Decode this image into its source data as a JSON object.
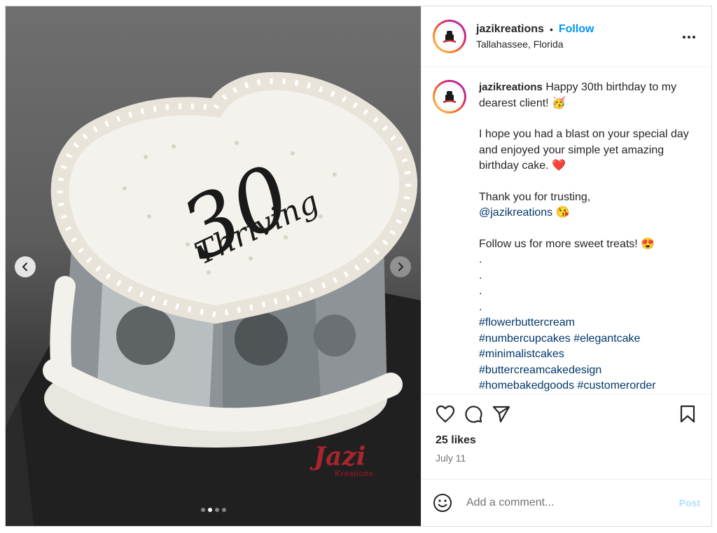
{
  "header": {
    "username": "jazikreations",
    "separator": "•",
    "follow_label": "Follow",
    "location": "Tallahassee, Florida"
  },
  "media": {
    "topper_number": "30",
    "topper_word": "Thriving",
    "watermark_line1": "Jazi",
    "watermark_line2": "Kreations",
    "carousel_count": 4,
    "carousel_active_index": 1
  },
  "caption": {
    "username": "jazikreations",
    "line1": "Happy 30th birthday to my dearest client! 🥳",
    "line2": "I hope you had a blast on your special day and enjoyed your simple yet amazing birthday cake. ❤️",
    "line3_prefix": "Thank you for trusting,",
    "mention": "@jazikreations",
    "line3_suffix": " 😘",
    "line4": "Follow us for more sweet treats! 😍",
    "dot": ".",
    "hashtags": [
      "#flowerbuttercream",
      "#numbercupcakes #elegantcake",
      "#minimalistcakes",
      "#buttercreamcakedesign",
      "#homebakedgoods #customerorder"
    ]
  },
  "engagement": {
    "likes": "25 likes",
    "date": "July 11"
  },
  "comment": {
    "placeholder": "Add a comment...",
    "post_label": "Post"
  },
  "icons": {
    "more": "more-horizontal-icon",
    "like": "heart-icon",
    "comment": "comment-bubble-icon",
    "share": "paper-plane-icon",
    "save": "bookmark-icon",
    "emoji": "emoji-smile-icon",
    "prev": "chevron-left-icon",
    "next": "chevron-right-icon"
  },
  "colors": {
    "follow": "#0095f6",
    "hashtag": "#00376b",
    "post_disabled": "#b2dffc",
    "muted": "#737373"
  }
}
